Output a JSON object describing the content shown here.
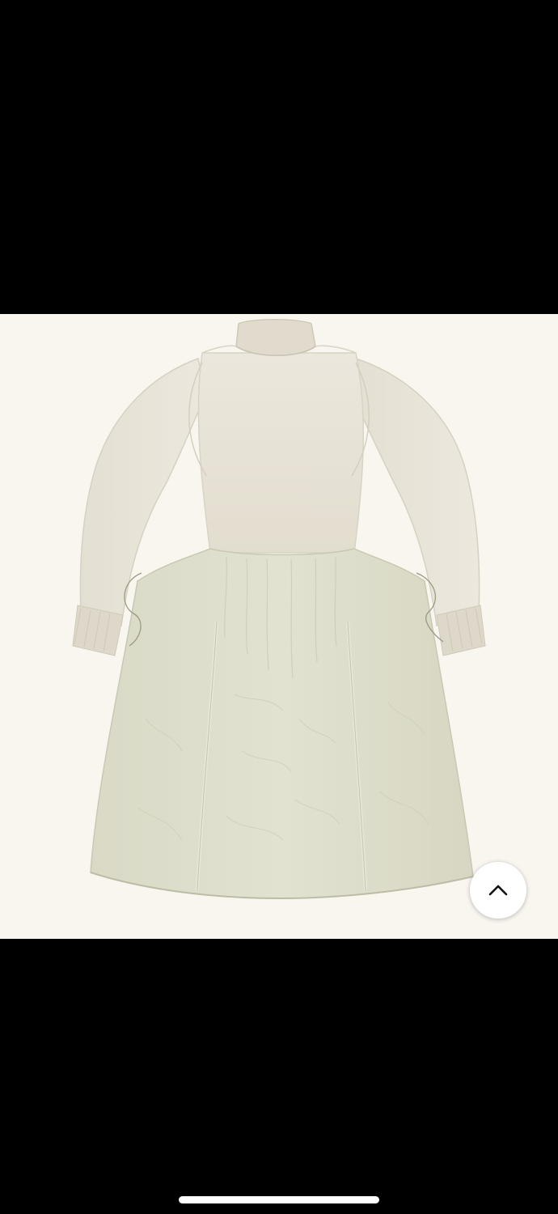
{
  "viewer": {
    "background": "#000000",
    "photo": {
      "subject_icon": "dress-photo",
      "background_color": "#f8f6ef",
      "bodice_color": "#e7e2d5",
      "skirt_color": "#dcdccb",
      "alt": ""
    },
    "scroll_top_button": {
      "icon": "chevron-up-icon",
      "color": "#ffffff"
    },
    "home_indicator": {
      "color": "#ffffff"
    }
  }
}
